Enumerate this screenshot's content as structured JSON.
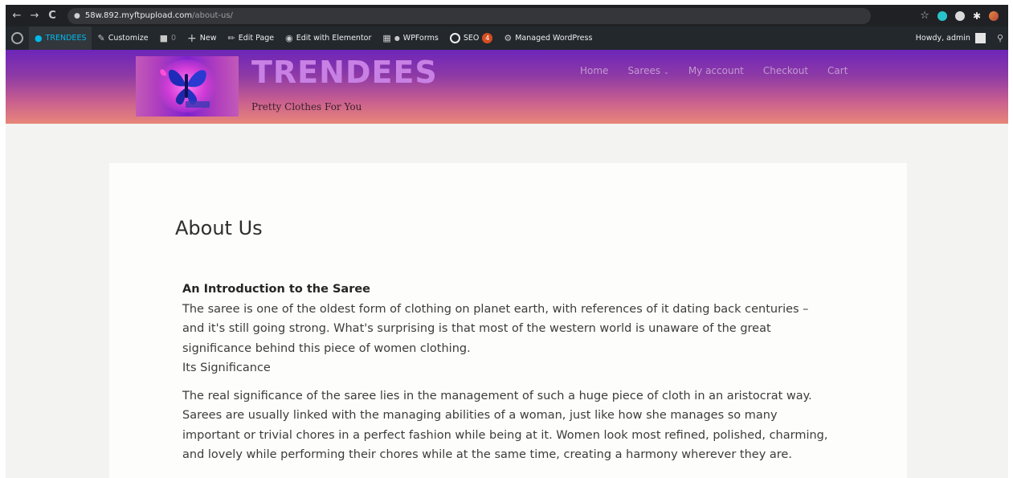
{
  "browser": {
    "url_host": "58w.892.myftpupload.com",
    "url_path": "/about-us/",
    "back_glyph": "←",
    "forward_glyph": "→",
    "reload_glyph": "C",
    "star_glyph": "☆",
    "extensions": [
      "teal-circle-extension-icon",
      "white-circle-extension-icon",
      "puzzle-extension-icon",
      "profile-icon"
    ]
  },
  "admin_bar": {
    "site_name": "TRENDEES",
    "customize": "Customize",
    "comments_count": "0",
    "new": "New",
    "edit_page": "Edit Page",
    "edit_elementor": "Edit with Elementor",
    "wpforms": "WPForms",
    "seo": "SEO",
    "seo_badge": "4",
    "managed": "Managed WordPress",
    "howdy": "Howdy, admin"
  },
  "header": {
    "title": "TRENDEES",
    "tagline": "Pretty Clothes For You",
    "nav": [
      "Home",
      "Sarees",
      "My account",
      "Checkout",
      "Cart"
    ],
    "dropdown_glyph": "⌄"
  },
  "page": {
    "heading": "About Us",
    "intro_heading": "An Introduction to the Saree",
    "intro_text": "The saree is one of the oldest form of clothing on planet earth, with references of it dating back centuries – and it's still going strong. What's surprising is that most of the western world is unaware of the great significance behind this piece of women clothing.",
    "significance_heading": "Its Significance",
    "significance_text": "The real significance of the saree lies in the management of such a huge piece of cloth in an aristocrat way. Sarees are usually linked with the managing abilities of a woman, just like how she manages so many important or trivial chores in a perfect fashion while being at it. Women look most refined, polished, charming, and lovely while performing their chores while at the same time, creating a harmony wherever they are."
  },
  "colors": {
    "header_top": "#6c25b9",
    "header_bottom": "#e8867a",
    "title": "#c880e4",
    "admin_bar": "#23282d"
  }
}
